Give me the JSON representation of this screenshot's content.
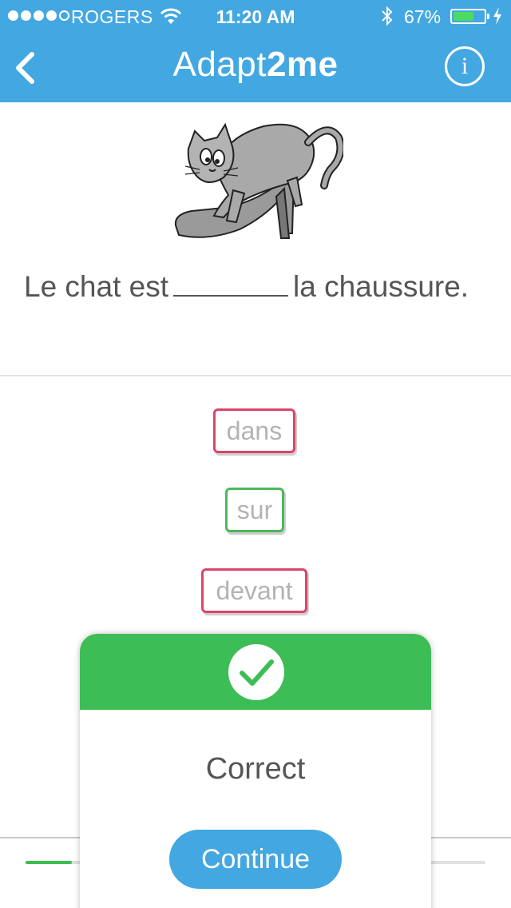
{
  "status_bar": {
    "carrier": "ROGERS",
    "time": "11:20 AM",
    "battery_percent": "67%",
    "battery_level": 0.67,
    "signal_bars_filled": 4,
    "signal_bars_total": 5
  },
  "nav": {
    "title_prefix": "Adapt",
    "title_suffix": "2me",
    "info_label": "i",
    "back_icon": "chevron-left-icon"
  },
  "question": {
    "before": "Le chat est",
    "after": "la chaussure.",
    "illustration": "cat-on-high-heel-shoe"
  },
  "options": [
    {
      "label": "dans",
      "state": "wrong"
    },
    {
      "label": "sur",
      "state": "correct"
    },
    {
      "label": "devant",
      "state": "wrong"
    }
  ],
  "progress": {
    "fraction": 0.1
  },
  "dialog": {
    "result": "Correct",
    "continue_label": "Continue",
    "icon": "check-icon"
  },
  "colors": {
    "accent_blue": "#43a7e1",
    "correct_green": "#3cbd55",
    "wrong_red": "#d9456a"
  }
}
